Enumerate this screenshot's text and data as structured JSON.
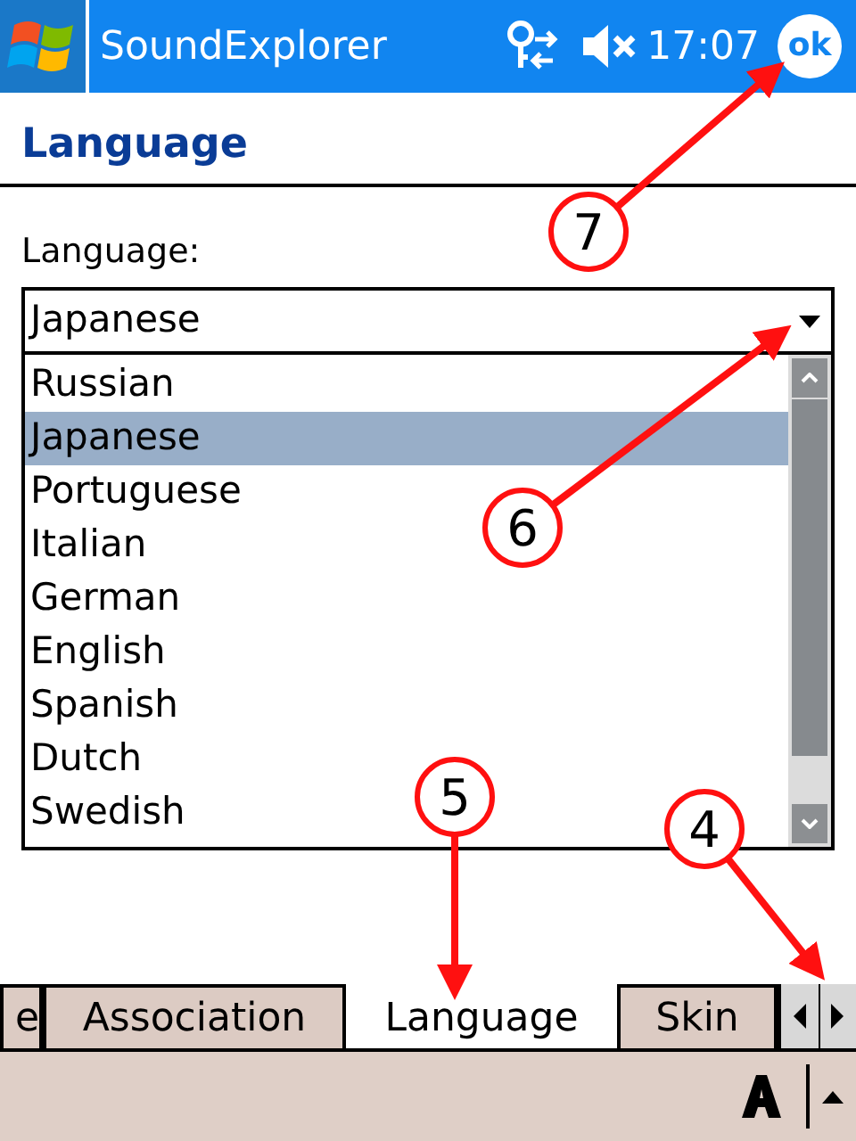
{
  "title_bar": {
    "title": "SoundExplorer",
    "time": "17:07",
    "ok": "ok"
  },
  "heading": "Language",
  "field_label": "Language:",
  "combo": {
    "value": "Japanese",
    "expanded": true
  },
  "options": [
    {
      "label": "Russian",
      "selected": false
    },
    {
      "label": "Japanese",
      "selected": true
    },
    {
      "label": "Portuguese",
      "selected": false
    },
    {
      "label": "Italian",
      "selected": false
    },
    {
      "label": "German",
      "selected": false
    },
    {
      "label": "English",
      "selected": false
    },
    {
      "label": "Spanish",
      "selected": false
    },
    {
      "label": "Dutch",
      "selected": false
    },
    {
      "label": "Swedish",
      "selected": false
    }
  ],
  "tabs": [
    {
      "label": "e",
      "selected": false
    },
    {
      "label": "Association",
      "selected": false
    },
    {
      "label": "Language",
      "selected": true
    },
    {
      "label": "Skin",
      "selected": false
    }
  ],
  "callouts": [
    {
      "label": "7"
    },
    {
      "label": "6"
    },
    {
      "label": "5"
    },
    {
      "label": "4"
    }
  ]
}
